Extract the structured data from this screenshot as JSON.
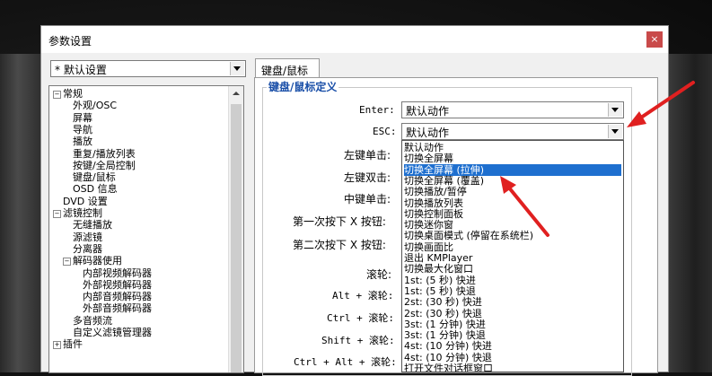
{
  "dialog": {
    "title": "参数设置",
    "close_label": "×"
  },
  "preset": {
    "value": "* 默认设置"
  },
  "tree": {
    "items": [
      {
        "label": "常规",
        "toggle": "−"
      },
      {
        "label": "外观/OSC"
      },
      {
        "label": "屏幕"
      },
      {
        "label": "导航"
      },
      {
        "label": "播放"
      },
      {
        "label": "重复/播放列表"
      },
      {
        "label": "按键/全局控制"
      },
      {
        "label": "键盘/鼠标"
      },
      {
        "label": "OSD 信息"
      },
      {
        "label": "DVD 设置"
      },
      {
        "label": "滤镜控制",
        "toggle": "−"
      },
      {
        "label": "无缝播放"
      },
      {
        "label": "源滤镜"
      },
      {
        "label": "分离器"
      },
      {
        "label": "解码器使用",
        "toggle": "−"
      },
      {
        "label": "内部视频解码器"
      },
      {
        "label": "外部视频解码器"
      },
      {
        "label": "内部音频解码器"
      },
      {
        "label": "外部音频解码器"
      },
      {
        "label": "多音频流"
      },
      {
        "label": "自定义滤镜管理器"
      },
      {
        "label": "插件",
        "toggle": "+"
      }
    ]
  },
  "tab": {
    "label": "键盘/鼠标"
  },
  "group": {
    "title": "键盘/鼠标定义"
  },
  "fields": {
    "enter_label": "Enter:",
    "enter_value": "默认动作",
    "esc_label": "ESC:",
    "esc_value": "默认动作",
    "left_click": "左键单击:",
    "left_dblclick": "左键双击:",
    "middle_click": "中键单击:",
    "x1": "第一次按下 X 按钮:",
    "x2": "第二次按下 X 按钮:",
    "wheel": "滚轮:",
    "alt_wheel": "Alt + 滚轮:",
    "ctrl_wheel": "Ctrl + 滚轮:",
    "shift_wheel": "Shift + 滚轮:",
    "ctrl_alt_wheel": "Ctrl + Alt + 滚轮:"
  },
  "dropdown": {
    "selected_index": 2,
    "options": [
      "默认动作",
      "切换全屏幕",
      "切换全屏幕 (拉伸)",
      "切换全屏幕 (覆盖)",
      "切换播放/暂停",
      "切换播放列表",
      "切换控制面板",
      "切换迷你窗",
      "切换桌面模式 (停留在系统栏)",
      "切换画面比",
      "退出 KMPlayer",
      "切换最大化窗口",
      "1st: (5 秒) 快进",
      "1st: (5 秒) 快退",
      "2st: (30 秒) 快进",
      "2st: (30 秒) 快退",
      "3st: (1 分钟) 快进",
      "3st: (1 分钟) 快退",
      "4st: (10 分钟) 快进",
      "4st: (10 分钟) 快退",
      "打开文件对话框窗口"
    ]
  },
  "colors": {
    "accent": "#1e6fcf",
    "annotation_arrow": "#e02020",
    "group_title": "#1a4fa8"
  }
}
